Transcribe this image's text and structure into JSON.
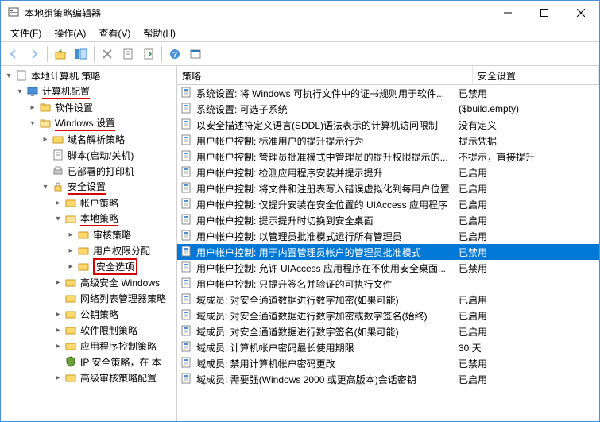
{
  "window": {
    "title": "本地组策略编辑器"
  },
  "menu": {
    "file": "文件(F)",
    "action": "操作(A)",
    "view": "查看(V)",
    "help": "帮助(H)"
  },
  "tree": {
    "root": "本地计算机 策略",
    "computer": "计算机配置",
    "software": "软件设置",
    "windows": "Windows 设置",
    "dns": "域名解析策略",
    "scripts": "脚本(启动/关机)",
    "printers": "已部署的打印机",
    "security": "安全设置",
    "account": "帐户策略",
    "local": "本地策略",
    "audit": "审核策略",
    "rights": "用户权限分配",
    "options": "安全选项",
    "advfw": "高级安全 Windows",
    "netlist": "网络列表管理器策略",
    "pubkey": "公钥策略",
    "swrestrict": "软件限制策略",
    "appctrl": "应用程序控制策略",
    "ipsec": "IP 安全策略，在 本",
    "advaudit": "高级审核策略配置"
  },
  "columns": {
    "policy": "策略",
    "setting": "安全设置"
  },
  "rows": [
    {
      "name": "系统设置: 将 Windows 可执行文件中的证书规则用于软件...",
      "value": "已禁用",
      "selected": false
    },
    {
      "name": "系统设置: 可选子系统",
      "value": "($build.empty)",
      "selected": false
    },
    {
      "name": "以安全描述符定义语言(SDDL)语法表示的计算机访问限制",
      "value": "没有定义",
      "selected": false
    },
    {
      "name": "用户帐户控制: 标准用户的提升提示行为",
      "value": "提示凭据",
      "selected": false
    },
    {
      "name": "用户帐户控制: 管理员批准模式中管理员的提升权限提示的...",
      "value": "不提示，直接提升",
      "selected": false
    },
    {
      "name": "用户帐户控制: 检测应用程序安装并提示提升",
      "value": "已启用",
      "selected": false
    },
    {
      "name": "用户帐户控制: 将文件和注册表写入错误虚拟化到每用户位置",
      "value": "已启用",
      "selected": false
    },
    {
      "name": "用户帐户控制: 仅提升安装在安全位置的 UIAccess 应用程序",
      "value": "已启用",
      "selected": false
    },
    {
      "name": "用户帐户控制: 提示提升时切换到安全桌面",
      "value": "已启用",
      "selected": false
    },
    {
      "name": "用户帐户控制: 以管理员批准模式运行所有管理员",
      "value": "已启用",
      "selected": false
    },
    {
      "name": "用户帐户控制: 用于内置管理员帐户的管理员批准模式",
      "value": "已禁用",
      "selected": true
    },
    {
      "name": "用户帐户控制: 允许 UIAccess 应用程序在不使用安全桌面...",
      "value": "已禁用",
      "selected": false
    },
    {
      "name": "用户帐户控制: 只提升签名并验证的可执行文件",
      "value": "",
      "selected": false
    },
    {
      "name": "域成员: 对安全通道数据进行数字加密(如果可能)",
      "value": "已启用",
      "selected": false
    },
    {
      "name": "域成员: 对安全通道数据进行数字加密或数字签名(始终)",
      "value": "已启用",
      "selected": false
    },
    {
      "name": "域成员: 对安全通道数据进行数字签名(如果可能)",
      "value": "已启用",
      "selected": false
    },
    {
      "name": "域成员: 计算机帐户密码最长使用期限",
      "value": "30 天",
      "selected": false
    },
    {
      "name": "域成员: 禁用计算机帐户密码更改",
      "value": "已禁用",
      "selected": false
    },
    {
      "name": "域成员: 需要强(Windows 2000 或更高版本)会话密钥",
      "value": "已启用",
      "selected": false
    }
  ]
}
